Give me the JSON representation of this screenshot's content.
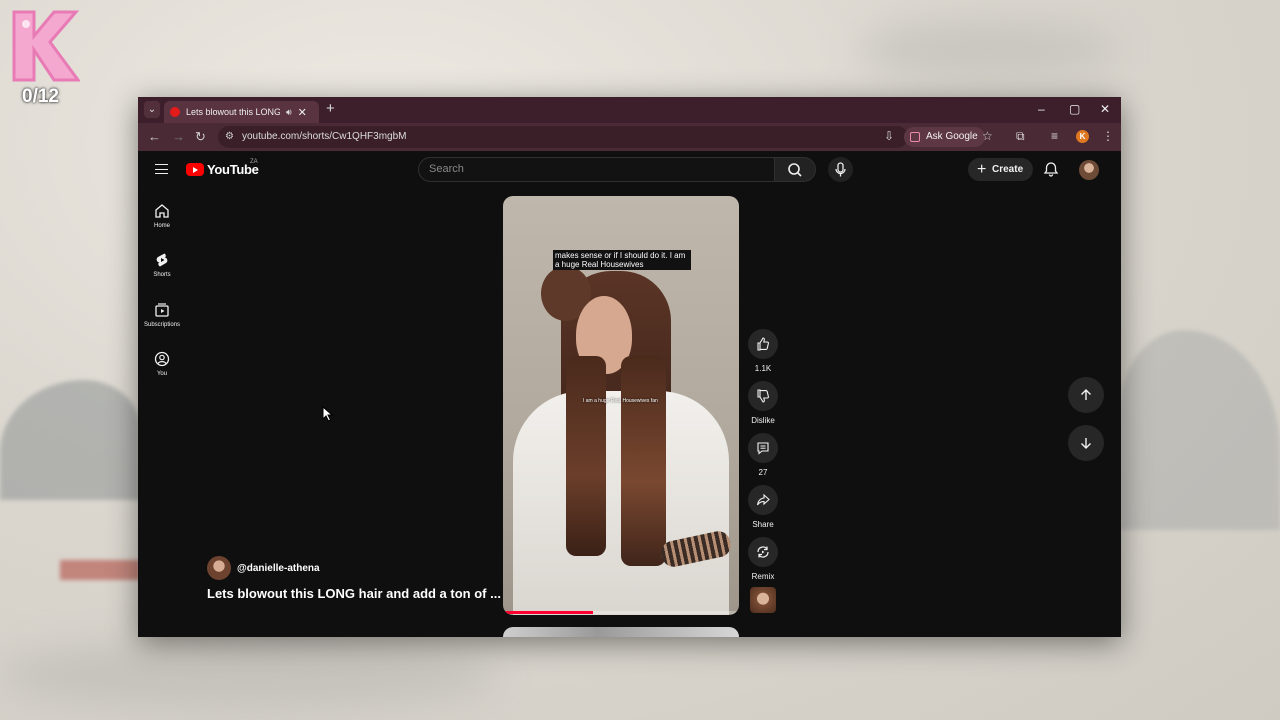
{
  "desktop": {
    "badge_letter": "K",
    "counter": "0/12"
  },
  "browser": {
    "tab_title": "Lets blowout this LONG hair",
    "url": "youtube.com/shorts/Cw1QHF3mgbM",
    "ask_google": "Ask Google",
    "profile_initial": "K"
  },
  "youtube": {
    "logo_text": "YouTube",
    "country_code": "ZA",
    "search_placeholder": "Search",
    "create_label": "Create",
    "sidebar": [
      {
        "label": "Home"
      },
      {
        "label": "Shorts"
      },
      {
        "label": "Subscriptions"
      },
      {
        "label": "You"
      }
    ],
    "video": {
      "caption": "makes sense or if I should do it. I am a huge Real Housewives",
      "overlay_text": "I am a huge Real Housewives fan",
      "progress": 0.38
    },
    "actions": {
      "like_count": "1.1K",
      "dislike_label": "Dislike",
      "comment_count": "27",
      "share_label": "Share",
      "remix_label": "Remix"
    },
    "channel": "@danielle-athena",
    "title": "Lets blowout this LONG hair and add a ton of ..."
  },
  "colors": {
    "accent": "#ff0000",
    "tabbar": "#3c1f2a",
    "toolbar": "#4a2a35"
  }
}
